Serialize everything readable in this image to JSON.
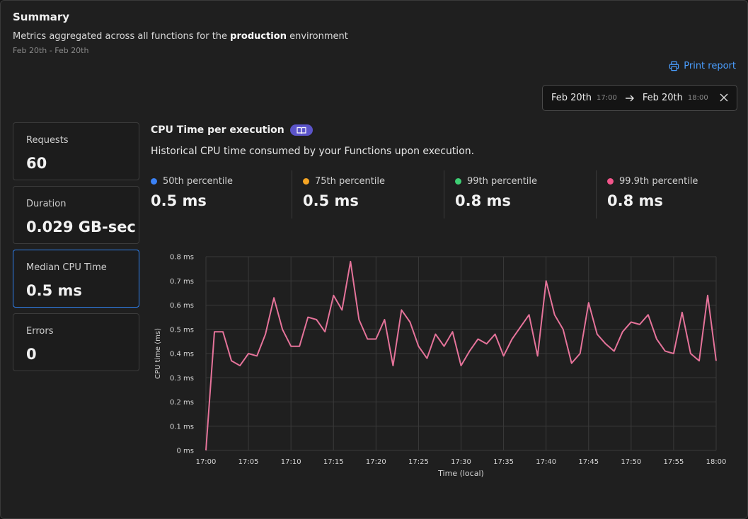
{
  "summary": {
    "title": "Summary",
    "subtitle_prefix": "Metrics aggregated across all functions for the ",
    "subtitle_env": "production",
    "subtitle_suffix": " environment",
    "date_caption": "Feb 20th - Feb 20th"
  },
  "print_label": "Print report",
  "range": {
    "start_date": "Feb 20th",
    "start_time": "17:00",
    "end_date": "Feb 20th",
    "end_time": "18:00"
  },
  "cards": [
    {
      "label": "Requests",
      "value": "60"
    },
    {
      "label": "Duration",
      "value": "0.029 GB-sec"
    },
    {
      "label": "Median CPU Time",
      "value": "0.5 ms"
    },
    {
      "label": "Errors",
      "value": "0"
    }
  ],
  "chart_header": {
    "title": "CPU Time per execution",
    "description": "Historical CPU time consumed by your Functions upon execution."
  },
  "percentiles": [
    {
      "label": "50th percentile",
      "value": "0.5 ms",
      "color": "#3b82f6"
    },
    {
      "label": "75th percentile",
      "value": "0.5 ms",
      "color": "#f5a524"
    },
    {
      "label": "99th percentile",
      "value": "0.8 ms",
      "color": "#3ecf74"
    },
    {
      "label": "99.9th percentile",
      "value": "0.8 ms",
      "color": "#f2558a"
    }
  ],
  "chart_data": {
    "type": "line",
    "xlabel": "Time (local)",
    "ylabel": "CPU time (ms)",
    "ylim": [
      0,
      0.8
    ],
    "xlim": [
      0,
      60
    ],
    "y_ticks": [
      "0 ms",
      "0.1 ms",
      "0.2 ms",
      "0.3 ms",
      "0.4 ms",
      "0.5 ms",
      "0.6 ms",
      "0.7 ms",
      "0.8 ms"
    ],
    "x_ticks": [
      "17:00",
      "17:05",
      "17:10",
      "17:15",
      "17:20",
      "17:25",
      "17:30",
      "17:35",
      "17:40",
      "17:45",
      "17:50",
      "17:55",
      "18:00"
    ],
    "grid": true,
    "series": [
      {
        "color": "#e5739a",
        "x": [
          0,
          1,
          2,
          3,
          4,
          5,
          6,
          7,
          8,
          9,
          10,
          11,
          12,
          13,
          14,
          15,
          16,
          17,
          18,
          19,
          20,
          21,
          22,
          23,
          24,
          25,
          26,
          27,
          28,
          29,
          30,
          31,
          32,
          33,
          34,
          35,
          36,
          37,
          38,
          39,
          40,
          41,
          42,
          43,
          44,
          45,
          46,
          47,
          48,
          49,
          50,
          51,
          52,
          53,
          54,
          55,
          56,
          57,
          58,
          59,
          60
        ],
        "values": [
          0,
          0.49,
          0.49,
          0.37,
          0.35,
          0.4,
          0.39,
          0.48,
          0.63,
          0.5,
          0.43,
          0.43,
          0.55,
          0.54,
          0.49,
          0.64,
          0.58,
          0.78,
          0.54,
          0.46,
          0.46,
          0.54,
          0.35,
          0.58,
          0.53,
          0.43,
          0.38,
          0.48,
          0.43,
          0.49,
          0.35,
          0.41,
          0.46,
          0.44,
          0.48,
          0.39,
          0.46,
          0.51,
          0.56,
          0.39,
          0.7,
          0.56,
          0.5,
          0.36,
          0.4,
          0.61,
          0.48,
          0.44,
          0.41,
          0.49,
          0.53,
          0.52,
          0.56,
          0.46,
          0.41,
          0.4,
          0.57,
          0.4,
          0.37,
          0.64,
          0.37
        ]
      }
    ]
  }
}
